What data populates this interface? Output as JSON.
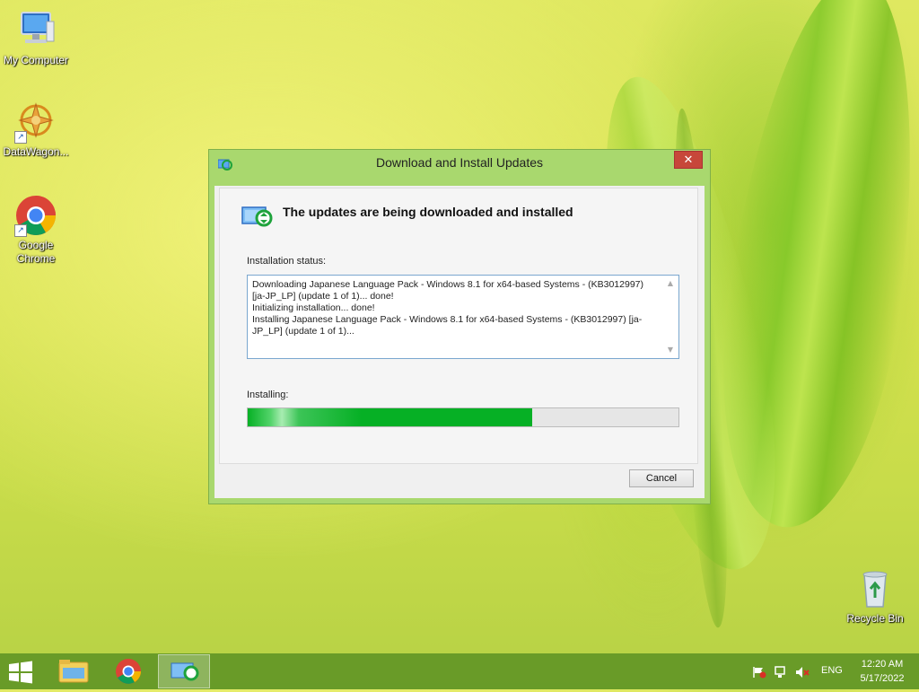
{
  "desktop": {
    "icons": [
      {
        "label": "My Computer"
      },
      {
        "label": "DataWagon..."
      },
      {
        "label": "Google Chrome"
      },
      {
        "label": "Recycle Bin"
      }
    ]
  },
  "dialog": {
    "title": "Download and Install Updates",
    "close_label": "✕",
    "heading": "The updates are being downloaded and installed",
    "status_label": "Installation status:",
    "status_lines": [
      "Downloading Japanese Language Pack - Windows 8.1 for x64-based Systems - (KB3012997)",
      "[ja-JP_LP] (update 1 of 1)... done!",
      "Initializing installation... done!",
      "Installing Japanese Language Pack - Windows 8.1 for x64-based Systems - (KB3012997) [ja-",
      "JP_LP] (update 1 of 1)..."
    ],
    "progress_label": "Installing:",
    "progress_fraction": 0.66,
    "cancel_label": "Cancel"
  },
  "taskbar": {
    "language": "ENG",
    "time": "12:20 AM",
    "date": "5/17/2022",
    "pinned": [
      "file-explorer-icon",
      "chrome-icon",
      "windows-update-icon"
    ]
  },
  "colors": {
    "progress_green": "#06b025",
    "close_red": "#c7473a",
    "dialog_frame": "#a9d86e",
    "taskbar": "#62962a"
  }
}
